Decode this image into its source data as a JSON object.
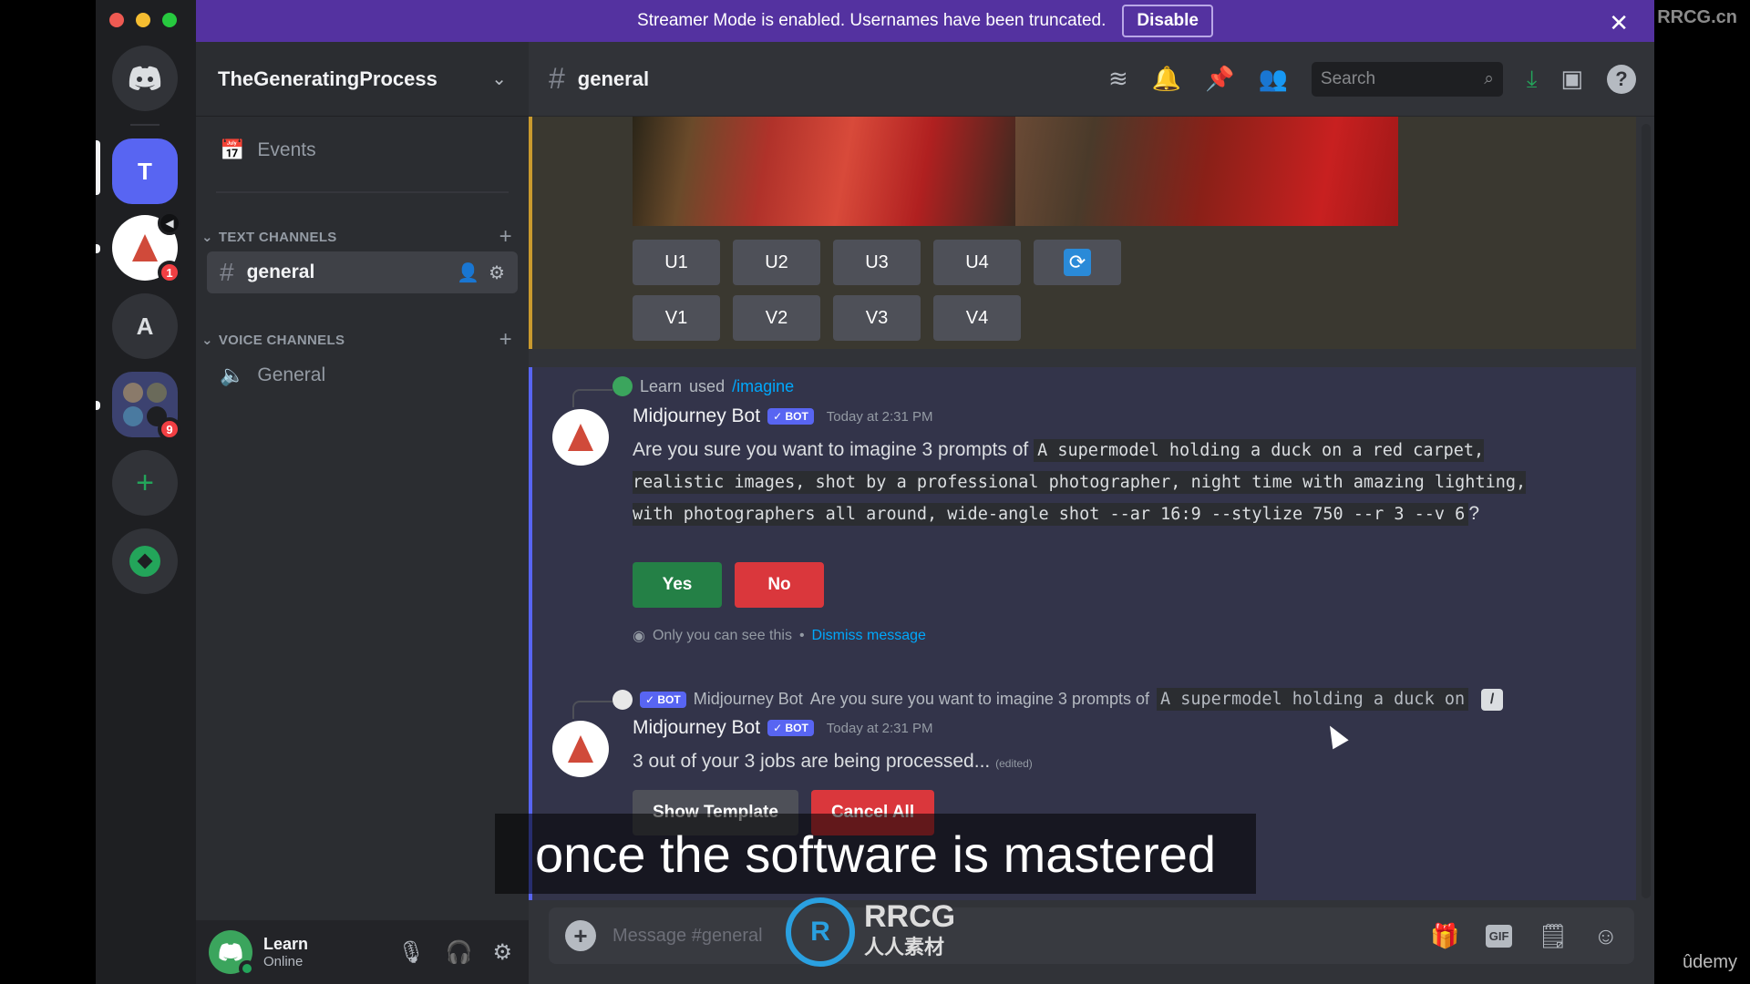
{
  "window": {
    "traffic_lights": [
      "close",
      "minimize",
      "maximize"
    ]
  },
  "banner": {
    "text": "Streamer Mode is enabled. Usernames have been truncated.",
    "button": "Disable",
    "close_icon": "close-icon",
    "color": "#5432a0"
  },
  "rail": {
    "home_icon": "discord-logo-icon",
    "servers": [
      {
        "label": "T",
        "active": true
      },
      {
        "label": "Midjourney",
        "badge": "1",
        "voice": true
      },
      {
        "label": "A"
      },
      {
        "label": "Server folder",
        "badge": "9"
      }
    ],
    "add_server_icon": "plus-icon",
    "discover_icon": "compass-icon"
  },
  "sidebar": {
    "guild_name": "TheGeneratingProcess",
    "events_label": "Events",
    "text_category": "TEXT CHANNELS",
    "voice_category": "VOICE CHANNELS",
    "text_channels": [
      {
        "name": "general",
        "selected": true
      }
    ],
    "voice_channels": [
      {
        "name": "General"
      }
    ]
  },
  "user": {
    "name": "Learn",
    "status": "Online"
  },
  "header": {
    "channel": "general",
    "search_placeholder": "Search",
    "icons": [
      "threads-icon",
      "bell-icon",
      "pin-icon",
      "members-icon",
      "download-icon",
      "inbox-icon",
      "help-icon"
    ]
  },
  "messages": {
    "upscale_buttons": [
      "U1",
      "U2",
      "U3",
      "U4"
    ],
    "variation_buttons": [
      "V1",
      "V2",
      "V3",
      "V4"
    ],
    "msg1": {
      "reply_user": "Learn",
      "reply_used": "used",
      "reply_command": "/imagine",
      "author": "Midjourney Bot",
      "badge": "✓ BOT",
      "timestamp": "Today at 2:31 PM",
      "text_prefix": "Are you sure you want to imagine 3 prompts of",
      "prompt": "A supermodel holding a duck on a red carpet, realistic images, shot by a professional photographer, night time with amazing lighting, with photographers all around, wide-angle shot --ar 16:9 --stylize 750 --r 3  --v 6",
      "text_suffix": "?",
      "yes": "Yes",
      "no": "No",
      "ephemeral_note": "Only you can see this",
      "dismiss": "Dismiss message"
    },
    "msg2": {
      "reply_badge": "✓ BOT",
      "reply_author": "Midjourney Bot",
      "reply_text": "Are you sure you want to imagine 3 prompts of",
      "reply_prompt": "A supermodel holding a duck on",
      "author": "Midjourney Bot",
      "badge": "✓ BOT",
      "timestamp": "Today at 2:31 PM",
      "text": "3 out of your 3 jobs are being processed...",
      "edited": "(edited)",
      "show_template": "Show Template",
      "cancel_all": "Cancel All"
    }
  },
  "composer": {
    "placeholder": "Message #general"
  },
  "overlay": {
    "caption": "once the software is mastered",
    "corner_watermark": "RRCG.cn",
    "logo_text": "RRCG",
    "logo_sub": "人人素材",
    "udemy": "ûdemy"
  }
}
